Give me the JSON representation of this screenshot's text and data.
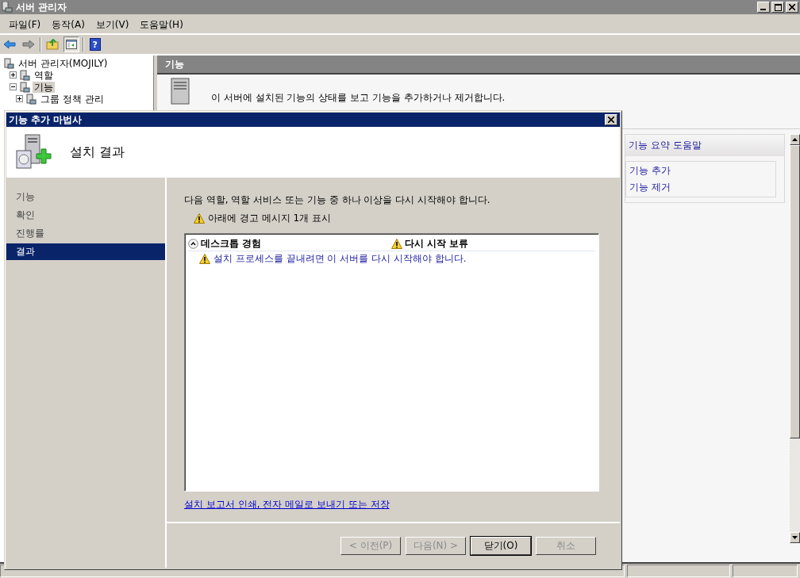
{
  "window": {
    "title": "서버 관리자"
  },
  "toolbar": {
    "help_glyph": "?"
  },
  "menu": [
    "파일(F)",
    "동작(A)",
    "보기(V)",
    "도움말(H)"
  ],
  "tree": [
    {
      "label": "서버 관리자(MOJILY)",
      "selected": false,
      "children": [
        {
          "label": "역할",
          "expanded": false,
          "selected": false
        },
        {
          "label": "기능",
          "expanded": true,
          "selected": true,
          "children": [
            {
              "label": "그룹 정책 관리",
              "expanded": false,
              "selected": false
            }
          ]
        }
      ]
    }
  ],
  "pane": {
    "title": "기능",
    "description": "이 서버에 설치된 기능의 상태를 보고 기능을 추가하거나 제거합니다.",
    "help_title": "기능 요약 도움말",
    "actions": [
      "기능 추가",
      "기능 제거"
    ]
  },
  "dialog": {
    "title": "기능 추가 마법사",
    "heading": "설치 결과",
    "steps": [
      {
        "label": "기능",
        "selected": false
      },
      {
        "label": "확인",
        "selected": false
      },
      {
        "label": "진행률",
        "selected": false
      },
      {
        "label": "결과",
        "selected": true
      }
    ],
    "message": "다음 역할, 역할 서비스 또는 기능 중 하나 이상을 다시 시작해야 합니다.",
    "warning_summary": "아래에 경고 메시지 1개 표시",
    "results": [
      {
        "name": "데스크톱 경험",
        "expanded": true,
        "status": "다시 시작 보류",
        "messages": [
          "설치 프로세스를 끝내려면 이 서버를 다시 시작해야 합니다."
        ]
      }
    ],
    "report_link": "설치 보고서 인쇄, 전자 메일로 보내기 또는 저장",
    "buttons": [
      {
        "label": "< 이전(P)",
        "disabled": true,
        "default": false
      },
      {
        "label": "다음(N) >",
        "disabled": true,
        "default": false
      },
      {
        "label": "닫기(O)",
        "disabled": false,
        "default": true
      },
      {
        "label": "취소",
        "disabled": true,
        "default": false
      }
    ]
  }
}
